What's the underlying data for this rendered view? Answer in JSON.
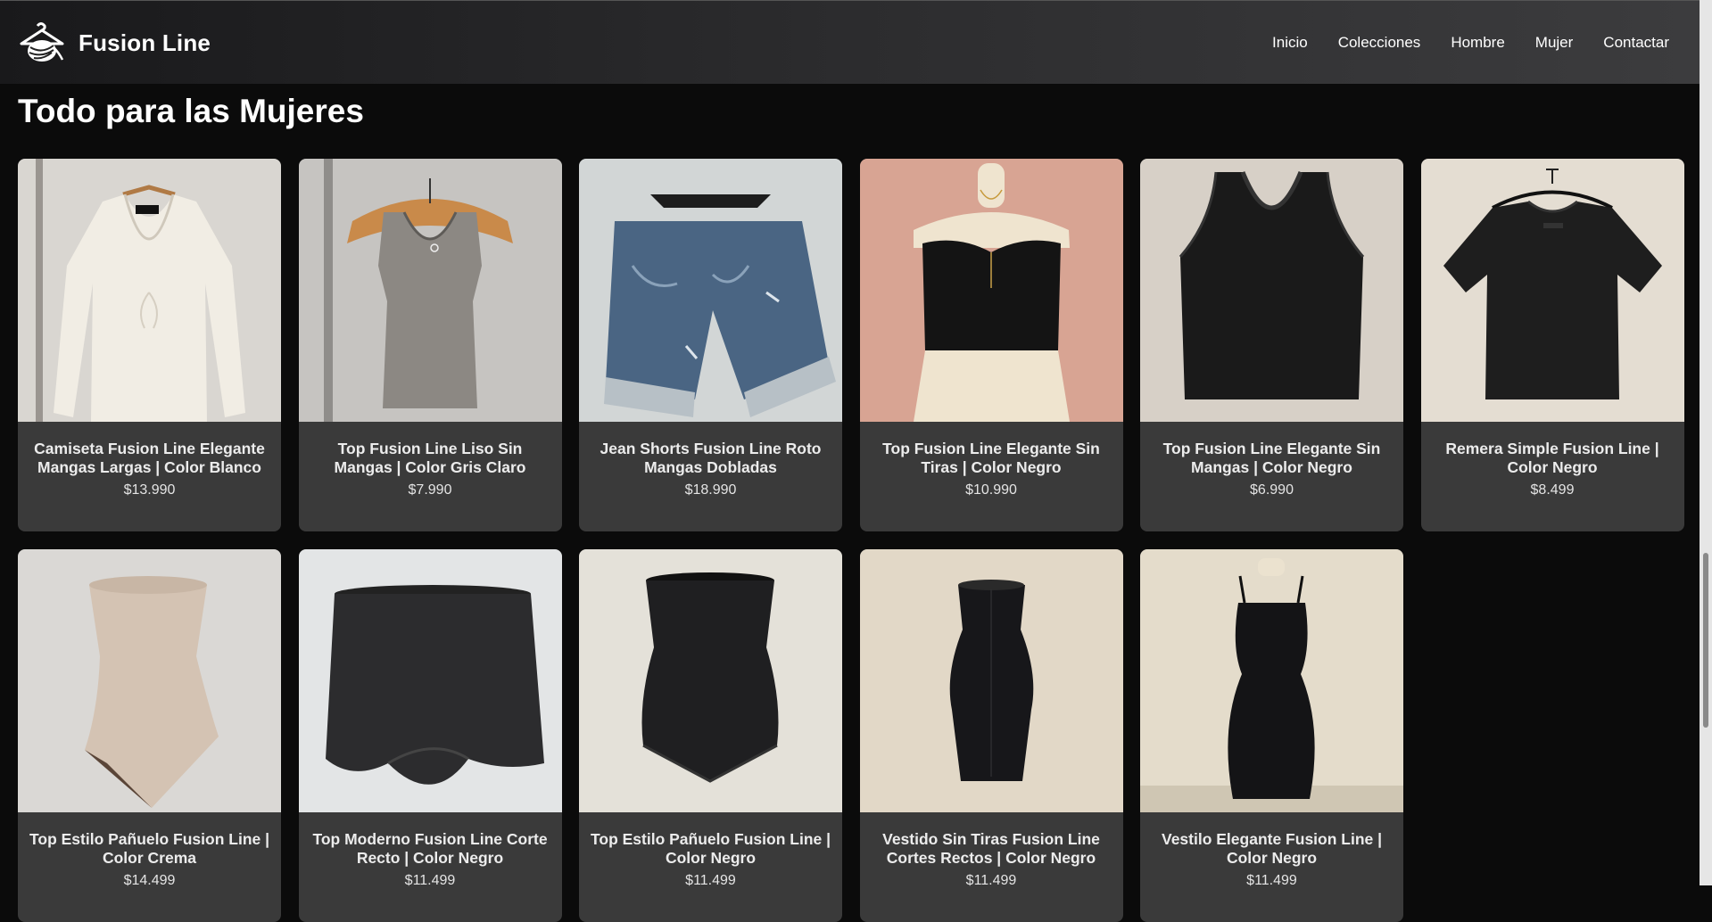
{
  "header": {
    "brand_name": "Fusion Line",
    "logo_icon": "hanger-yarn-logo",
    "nav": [
      "Inicio",
      "Colecciones",
      "Hombre",
      "Mujer",
      "Contactar"
    ]
  },
  "page_title": "Todo para las Mujeres",
  "products": [
    {
      "name": "Camiseta Fusion Line Elegante Mangas Largas | Color Blanco",
      "price": "$13.990",
      "image": "white-long-sleeve-shirt"
    },
    {
      "name": "Top Fusion Line Liso Sin Mangas | Color Gris Claro",
      "price": "$7.990",
      "image": "gray-tank-top"
    },
    {
      "name": "Jean Shorts Fusion Line Roto Mangas Dobladas",
      "price": "$18.990",
      "image": "denim-shorts"
    },
    {
      "name": "Top Fusion Line Elegante Sin Tiras | Color Negro",
      "price": "$10.990",
      "image": "black-strapless-top"
    },
    {
      "name": "Top Fusion Line Elegante Sin Mangas | Color Negro",
      "price": "$6.990",
      "image": "black-sleeveless-top"
    },
    {
      "name": "Remera Simple Fusion Line | Color Negro",
      "price": "$8.499",
      "image": "black-tshirt"
    },
    {
      "name": "Top Estilo Pañuelo Fusion Line | Color Crema",
      "price": "$14.499",
      "image": "cream-scarf-top"
    },
    {
      "name": "Top Moderno Fusion Line Corte Recto | Color Negro",
      "price": "$11.499",
      "image": "black-modern-top"
    },
    {
      "name": "Top Estilo Pañuelo Fusion Line | Color Negro",
      "price": "$11.499",
      "image": "black-scarf-top"
    },
    {
      "name": "Vestido Sin Tiras Fusion Line Cortes Rectos | Color Negro",
      "price": "$11.499",
      "image": "black-strapless-dress"
    },
    {
      "name": "Vestilo Elegante Fusion Line | Color Negro",
      "price": "$11.499",
      "image": "black-elegant-dress"
    }
  ]
}
